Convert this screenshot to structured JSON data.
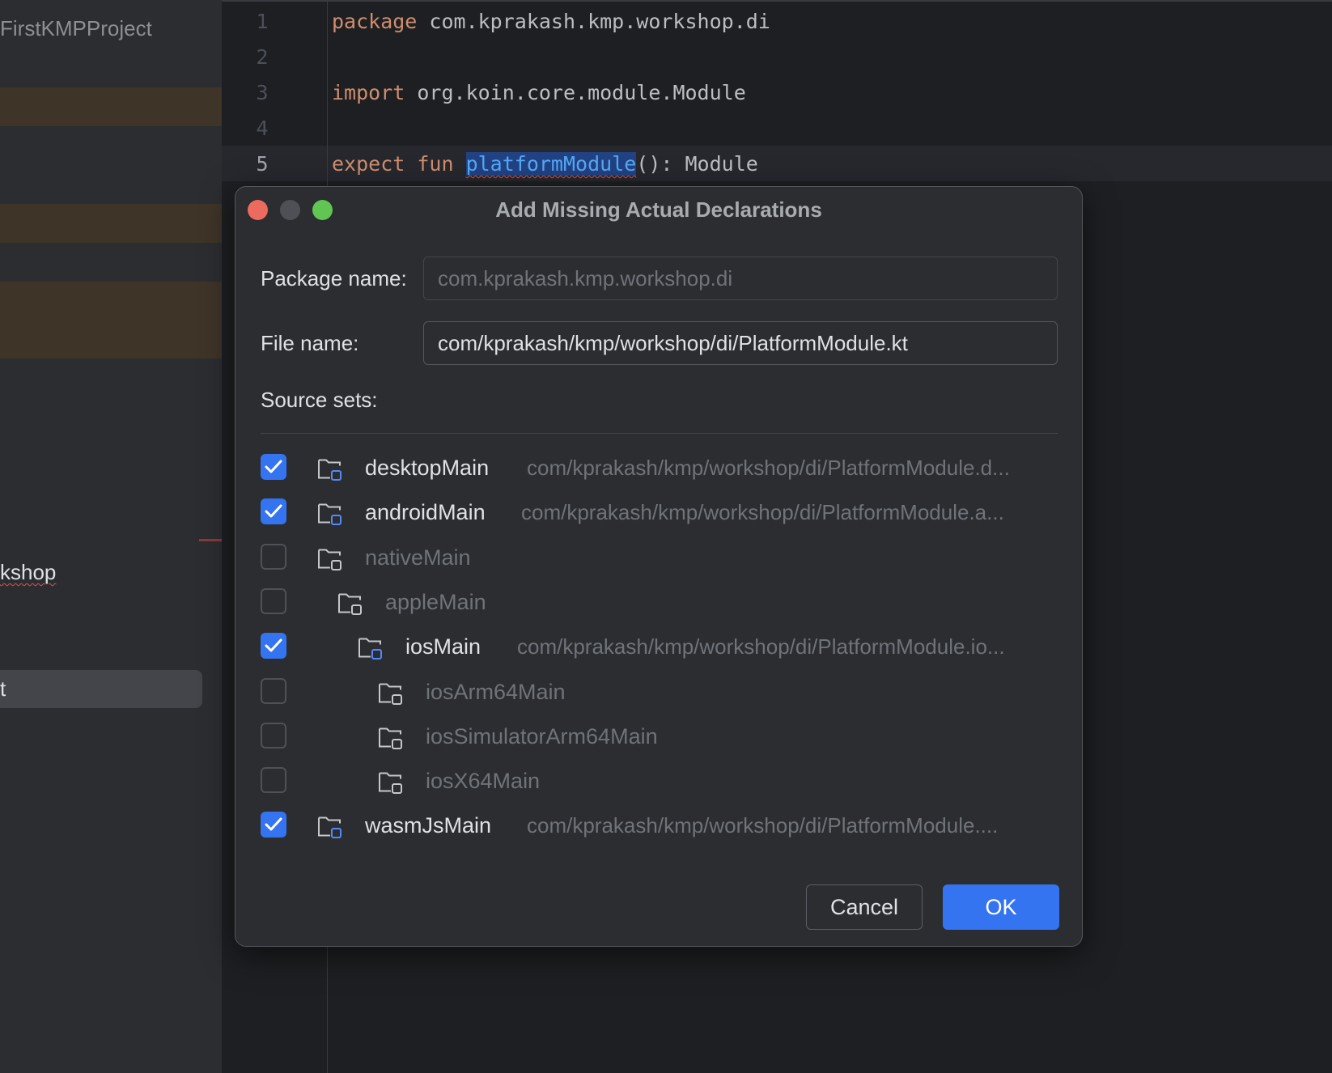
{
  "sidebar": {
    "project_title": "FirstKMPProject",
    "item_workshop": "kshop",
    "item_selected": "t"
  },
  "editor": {
    "lines": [
      {
        "number": "1",
        "keyword": "package",
        "rest": " com.kprakash.kmp.workshop.di"
      },
      {
        "number": "2"
      },
      {
        "number": "3",
        "keyword": "import",
        "rest": " org.koin.core.module.Module"
      },
      {
        "number": "4"
      },
      {
        "number": "5",
        "keyword": "expect fun",
        "ident": "platformModule",
        "rest": "(): Module"
      }
    ]
  },
  "dialog": {
    "title": "Add Missing Actual Declarations",
    "package_label": "Package name:",
    "package_value": "com.kprakash.kmp.workshop.di",
    "file_label": "File name:",
    "file_value": "com/kprakash/kmp/workshop/di/PlatformModule.kt",
    "source_sets_label": "Source sets:",
    "source_sets": [
      {
        "name": "desktopMain",
        "path": "com/kprakash/kmp/workshop/di/PlatformModule.d...",
        "checked": true
      },
      {
        "name": "androidMain",
        "path": "com/kprakash/kmp/workshop/di/PlatformModule.a...",
        "checked": true
      },
      {
        "name": "nativeMain",
        "path": "",
        "checked": false
      },
      {
        "name": "appleMain",
        "path": "",
        "checked": false
      },
      {
        "name": "iosMain",
        "path": "com/kprakash/kmp/workshop/di/PlatformModule.io...",
        "checked": true
      },
      {
        "name": "iosArm64Main",
        "path": "",
        "checked": false
      },
      {
        "name": "iosSimulatorArm64Main",
        "path": "",
        "checked": false
      },
      {
        "name": "iosX64Main",
        "path": "",
        "checked": false
      },
      {
        "name": "wasmJsMain",
        "path": "com/kprakash/kmp/workshop/di/PlatformModule....",
        "checked": true
      }
    ],
    "cancel_label": "Cancel",
    "ok_label": "OK"
  },
  "colors": {
    "accent": "#3574f0",
    "keyword": "#cf8e6d",
    "close": "#ed6a5e",
    "maximize": "#61c554"
  }
}
